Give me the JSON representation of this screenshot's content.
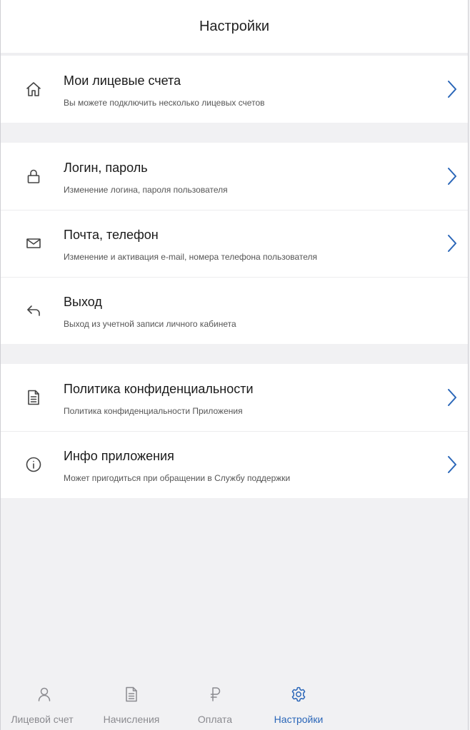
{
  "header": {
    "title": "Настройки"
  },
  "groups": [
    {
      "items": [
        {
          "icon": "home-icon",
          "title": "Мои лицевые счета",
          "subtitle": "Вы можете подключить несколько лицевых счетов",
          "chevron": true
        }
      ]
    },
    {
      "items": [
        {
          "icon": "lock-icon",
          "title": "Логин, пароль",
          "subtitle": "Изменение логина, пароля пользователя",
          "chevron": true
        },
        {
          "icon": "mail-icon",
          "title": "Почта, телефон",
          "subtitle": "Изменение и активация e-mail, номера телефона пользователя",
          "chevron": true
        },
        {
          "icon": "logout-arrow-icon",
          "title": "Выход",
          "subtitle": "Выход из учетной записи личного кабинета",
          "chevron": false
        }
      ]
    },
    {
      "items": [
        {
          "icon": "document-icon",
          "title": "Политика конфиденциальности",
          "subtitle": "Политика конфиденциальности Приложения",
          "chevron": true
        },
        {
          "icon": "info-icon",
          "title": "Инфо приложения",
          "subtitle": "Может пригодиться при обращении в Службу поддержки",
          "chevron": true
        }
      ]
    }
  ],
  "tabbar": {
    "tabs": [
      {
        "icon": "person-icon",
        "label": "Лицевой счет",
        "active": false
      },
      {
        "icon": "document-icon",
        "label": "Начисления",
        "active": false
      },
      {
        "icon": "ruble-icon",
        "label": "Оплата",
        "active": false
      },
      {
        "icon": "gear-icon",
        "label": "Настройки",
        "active": true
      }
    ]
  },
  "colors": {
    "accent": "#2a66b8",
    "inactive": "#8a8a8f",
    "background": "#f1f1f3"
  }
}
